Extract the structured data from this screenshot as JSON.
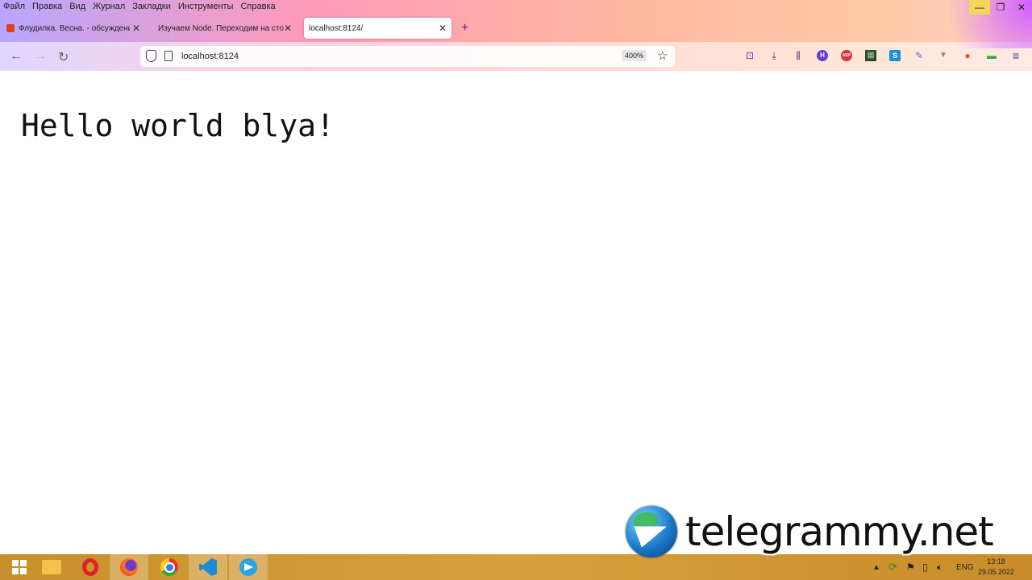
{
  "menu": [
    "Файл",
    "Правка",
    "Вид",
    "Журнал",
    "Закладки",
    "Инструменты",
    "Справка"
  ],
  "window_controls": {
    "minimize": "—",
    "restore": "❐",
    "close": "✕"
  },
  "tabs": [
    {
      "title": "Флудилка. Весна. - обсуждение",
      "close": "✕"
    },
    {
      "title": "Изучаем Node. Переходим на сторону сервера",
      "close": "✕"
    },
    {
      "title": "localhost:8124/",
      "close": "✕"
    }
  ],
  "new_tab": "+",
  "nav": {
    "back": "←",
    "forward": "→",
    "reload": "↻"
  },
  "url": "localhost:8124",
  "zoom": "400%",
  "star": "☆",
  "toolbar_icons": [
    "pocket-icon",
    "download-icon",
    "library-icon",
    "h-extension-icon",
    "adblock-icon",
    "extension-icon",
    "skype-icon",
    "pen-icon",
    "vpn-icon",
    "duckduckgo-icon",
    "money-icon",
    "menu-icon"
  ],
  "toolbar_glyphs": {
    "pocket": "⊡",
    "download": "⤓",
    "library": "⫼",
    "h": "H",
    "abp": "ABP",
    "ext": "▦",
    "s": "S",
    "pen": "✎",
    "v": "▼",
    "duck": "●",
    "money": "▬",
    "menu": "≡"
  },
  "content": {
    "heading": "Hello world blya!"
  },
  "watermark": "telegrammy.net",
  "tray": {
    "lang": "ENG",
    "time": "13:18",
    "date": "29.05.2022"
  },
  "colors": {
    "chrome_accent": "#5a2a86",
    "taskbar": "#d0962f",
    "minimize_hover": "#f5d55a"
  }
}
